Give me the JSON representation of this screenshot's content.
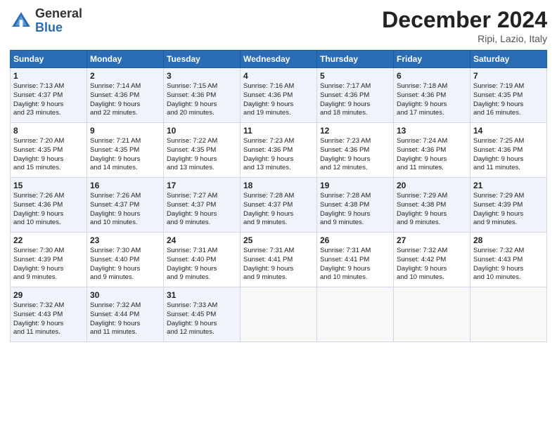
{
  "logo": {
    "general": "General",
    "blue": "Blue"
  },
  "header": {
    "month": "December 2024",
    "location": "Ripi, Lazio, Italy"
  },
  "days_of_week": [
    "Sunday",
    "Monday",
    "Tuesday",
    "Wednesday",
    "Thursday",
    "Friday",
    "Saturday"
  ],
  "weeks": [
    [
      {
        "day": "1",
        "lines": [
          "Sunrise: 7:13 AM",
          "Sunset: 4:37 PM",
          "Daylight: 9 hours",
          "and 23 minutes."
        ]
      },
      {
        "day": "2",
        "lines": [
          "Sunrise: 7:14 AM",
          "Sunset: 4:36 PM",
          "Daylight: 9 hours",
          "and 22 minutes."
        ]
      },
      {
        "day": "3",
        "lines": [
          "Sunrise: 7:15 AM",
          "Sunset: 4:36 PM",
          "Daylight: 9 hours",
          "and 20 minutes."
        ]
      },
      {
        "day": "4",
        "lines": [
          "Sunrise: 7:16 AM",
          "Sunset: 4:36 PM",
          "Daylight: 9 hours",
          "and 19 minutes."
        ]
      },
      {
        "day": "5",
        "lines": [
          "Sunrise: 7:17 AM",
          "Sunset: 4:36 PM",
          "Daylight: 9 hours",
          "and 18 minutes."
        ]
      },
      {
        "day": "6",
        "lines": [
          "Sunrise: 7:18 AM",
          "Sunset: 4:36 PM",
          "Daylight: 9 hours",
          "and 17 minutes."
        ]
      },
      {
        "day": "7",
        "lines": [
          "Sunrise: 7:19 AM",
          "Sunset: 4:35 PM",
          "Daylight: 9 hours",
          "and 16 minutes."
        ]
      }
    ],
    [
      {
        "day": "8",
        "lines": [
          "Sunrise: 7:20 AM",
          "Sunset: 4:35 PM",
          "Daylight: 9 hours",
          "and 15 minutes."
        ]
      },
      {
        "day": "9",
        "lines": [
          "Sunrise: 7:21 AM",
          "Sunset: 4:35 PM",
          "Daylight: 9 hours",
          "and 14 minutes."
        ]
      },
      {
        "day": "10",
        "lines": [
          "Sunrise: 7:22 AM",
          "Sunset: 4:35 PM",
          "Daylight: 9 hours",
          "and 13 minutes."
        ]
      },
      {
        "day": "11",
        "lines": [
          "Sunrise: 7:23 AM",
          "Sunset: 4:36 PM",
          "Daylight: 9 hours",
          "and 13 minutes."
        ]
      },
      {
        "day": "12",
        "lines": [
          "Sunrise: 7:23 AM",
          "Sunset: 4:36 PM",
          "Daylight: 9 hours",
          "and 12 minutes."
        ]
      },
      {
        "day": "13",
        "lines": [
          "Sunrise: 7:24 AM",
          "Sunset: 4:36 PM",
          "Daylight: 9 hours",
          "and 11 minutes."
        ]
      },
      {
        "day": "14",
        "lines": [
          "Sunrise: 7:25 AM",
          "Sunset: 4:36 PM",
          "Daylight: 9 hours",
          "and 11 minutes."
        ]
      }
    ],
    [
      {
        "day": "15",
        "lines": [
          "Sunrise: 7:26 AM",
          "Sunset: 4:36 PM",
          "Daylight: 9 hours",
          "and 10 minutes."
        ]
      },
      {
        "day": "16",
        "lines": [
          "Sunrise: 7:26 AM",
          "Sunset: 4:37 PM",
          "Daylight: 9 hours",
          "and 10 minutes."
        ]
      },
      {
        "day": "17",
        "lines": [
          "Sunrise: 7:27 AM",
          "Sunset: 4:37 PM",
          "Daylight: 9 hours",
          "and 9 minutes."
        ]
      },
      {
        "day": "18",
        "lines": [
          "Sunrise: 7:28 AM",
          "Sunset: 4:37 PM",
          "Daylight: 9 hours",
          "and 9 minutes."
        ]
      },
      {
        "day": "19",
        "lines": [
          "Sunrise: 7:28 AM",
          "Sunset: 4:38 PM",
          "Daylight: 9 hours",
          "and 9 minutes."
        ]
      },
      {
        "day": "20",
        "lines": [
          "Sunrise: 7:29 AM",
          "Sunset: 4:38 PM",
          "Daylight: 9 hours",
          "and 9 minutes."
        ]
      },
      {
        "day": "21",
        "lines": [
          "Sunrise: 7:29 AM",
          "Sunset: 4:39 PM",
          "Daylight: 9 hours",
          "and 9 minutes."
        ]
      }
    ],
    [
      {
        "day": "22",
        "lines": [
          "Sunrise: 7:30 AM",
          "Sunset: 4:39 PM",
          "Daylight: 9 hours",
          "and 9 minutes."
        ]
      },
      {
        "day": "23",
        "lines": [
          "Sunrise: 7:30 AM",
          "Sunset: 4:40 PM",
          "Daylight: 9 hours",
          "and 9 minutes."
        ]
      },
      {
        "day": "24",
        "lines": [
          "Sunrise: 7:31 AM",
          "Sunset: 4:40 PM",
          "Daylight: 9 hours",
          "and 9 minutes."
        ]
      },
      {
        "day": "25",
        "lines": [
          "Sunrise: 7:31 AM",
          "Sunset: 4:41 PM",
          "Daylight: 9 hours",
          "and 9 minutes."
        ]
      },
      {
        "day": "26",
        "lines": [
          "Sunrise: 7:31 AM",
          "Sunset: 4:41 PM",
          "Daylight: 9 hours",
          "and 10 minutes."
        ]
      },
      {
        "day": "27",
        "lines": [
          "Sunrise: 7:32 AM",
          "Sunset: 4:42 PM",
          "Daylight: 9 hours",
          "and 10 minutes."
        ]
      },
      {
        "day": "28",
        "lines": [
          "Sunrise: 7:32 AM",
          "Sunset: 4:43 PM",
          "Daylight: 9 hours",
          "and 10 minutes."
        ]
      }
    ],
    [
      {
        "day": "29",
        "lines": [
          "Sunrise: 7:32 AM",
          "Sunset: 4:43 PM",
          "Daylight: 9 hours",
          "and 11 minutes."
        ]
      },
      {
        "day": "30",
        "lines": [
          "Sunrise: 7:32 AM",
          "Sunset: 4:44 PM",
          "Daylight: 9 hours",
          "and 11 minutes."
        ]
      },
      {
        "day": "31",
        "lines": [
          "Sunrise: 7:33 AM",
          "Sunset: 4:45 PM",
          "Daylight: 9 hours",
          "and 12 minutes."
        ]
      },
      null,
      null,
      null,
      null
    ]
  ]
}
